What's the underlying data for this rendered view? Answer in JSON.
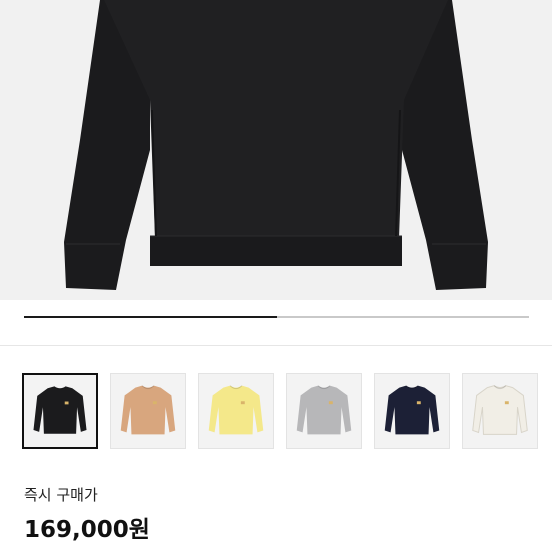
{
  "product": {
    "purchase_label": "즉시 구매가",
    "price": "169,000원"
  },
  "gallery": {
    "progress_fraction": 0.5
  },
  "swatches": [
    {
      "color": "#1b1b1d",
      "name": "black",
      "selected": true
    },
    {
      "color": "#d8a67e",
      "name": "beige",
      "selected": false
    },
    {
      "color": "#f4e88a",
      "name": "yellow",
      "selected": false
    },
    {
      "color": "#b7b7b9",
      "name": "grey",
      "selected": false
    },
    {
      "color": "#1c2036",
      "name": "navy",
      "selected": false
    },
    {
      "color": "#f1eee6",
      "name": "ivory",
      "selected": false
    }
  ],
  "hero_color": "#1b1b1d"
}
